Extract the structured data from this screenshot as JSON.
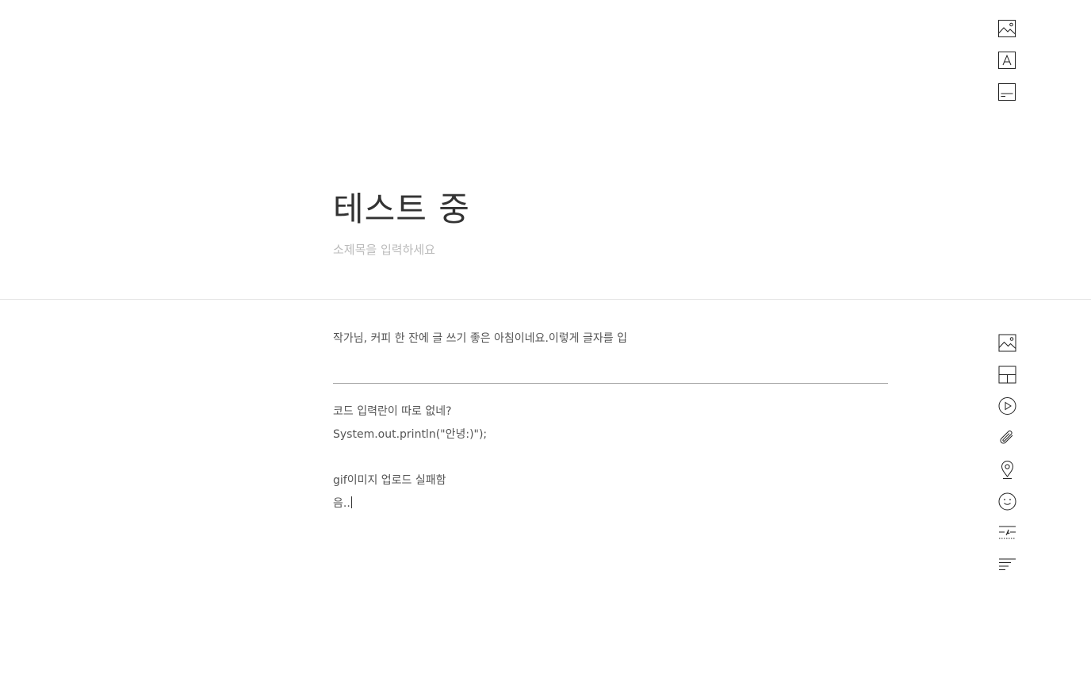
{
  "cover": {
    "title": "테스트 중",
    "subtitle_placeholder": "소제목을 입력하세요"
  },
  "cover_tools": [
    {
      "icon": "image-icon"
    },
    {
      "icon": "font-icon"
    },
    {
      "icon": "title-align-icon"
    }
  ],
  "body": {
    "intro": "작가님, 커피 한 잔에 글 쓰기 좋은 아침이네요.이렇게 글자를 입",
    "lines": [
      "코드 입력란이 따로 없네?",
      "System.out.println(\"안녕:)\");",
      "",
      "gif이미지 업로드 실패함",
      "음.."
    ]
  },
  "body_tools": [
    {
      "icon": "image-icon"
    },
    {
      "icon": "layout-icon"
    },
    {
      "icon": "video-icon"
    },
    {
      "icon": "attachment-icon"
    },
    {
      "icon": "location-icon"
    },
    {
      "icon": "emoticon-icon"
    },
    {
      "icon": "divider-line-icon"
    },
    {
      "icon": "align-icon"
    }
  ]
}
